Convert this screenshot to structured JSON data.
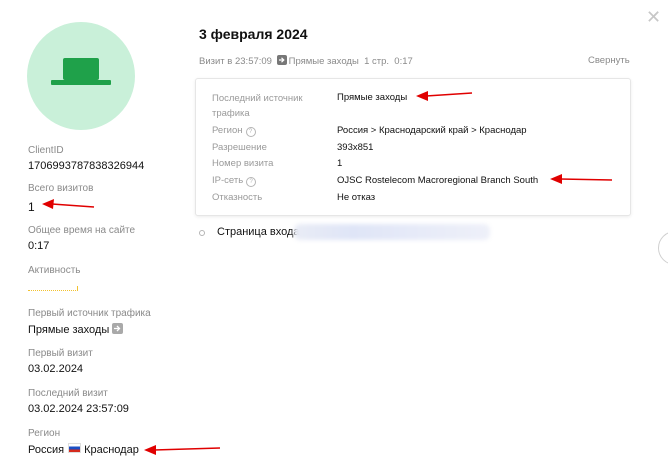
{
  "profile": {
    "client_id_label": "ClientID",
    "client_id": "1706993787838326944",
    "total_visits_label": "Всего визитов",
    "total_visits": "1",
    "total_time_label": "Общее время на сайте",
    "total_time": "0:17",
    "activity_label": "Активность",
    "first_source_label": "Первый источник трафика",
    "first_source": "Прямые заходы",
    "first_visit_label": "Первый визит",
    "first_visit": "03.02.2024",
    "last_visit_label": "Последний визит",
    "last_visit": "03.02.2024 23:57:09",
    "region_label": "Регион",
    "region_country": "Россия",
    "region_city": "Краснодар"
  },
  "visit": {
    "date": "3 февраля 2024",
    "time_text": "Визит в 23:57:09",
    "source": "Прямые заходы",
    "pages": "1 стр.",
    "duration": "0:17",
    "collapse_label": "Свернуть",
    "details": {
      "last_source_label_1": "Последний источник",
      "last_source_label_2": "трафика",
      "last_source": "Прямые заходы",
      "region_label": "Регион",
      "region": "Россия > Краснодарский край > Краснодар",
      "resolution_label": "Разрешение",
      "resolution": "393x851",
      "visit_number_label": "Номер визита",
      "visit_number": "1",
      "ip_network_label": "IP-сеть",
      "ip_network": "OJSC Rostelecom Macroregional Branch South",
      "bounce_label": "Отказность",
      "bounce": "Не отказ"
    },
    "entry_page_label": "Страница входа"
  },
  "colors": {
    "avatar_bg": "#c9f0d9",
    "avatar_icon": "#1fa14a",
    "annotation_arrow": "#e00000",
    "activity": "#f2c12e"
  },
  "icons": {
    "close": "close-icon",
    "avatar": "hat-icon",
    "source": "arrow-right-icon",
    "help": "question-icon",
    "flag": "russia-flag-icon"
  }
}
